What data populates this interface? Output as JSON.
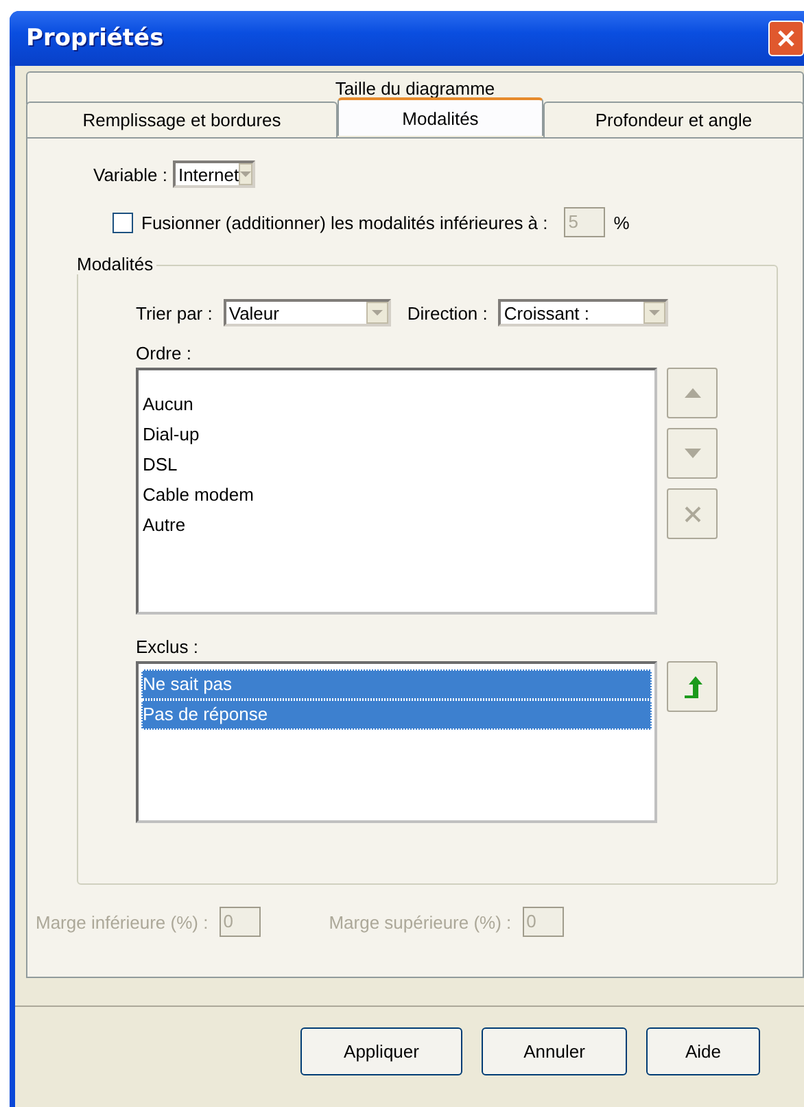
{
  "window": {
    "title": "Propriétés"
  },
  "tab_rows": [
    [
      {
        "label": "Taille du diagramme",
        "selected": false
      }
    ],
    [
      {
        "label": "Remplissage et bordures",
        "selected": false
      },
      {
        "label": "Modalités",
        "selected": true
      },
      {
        "label": "Profondeur et angle",
        "selected": false
      }
    ]
  ],
  "variable": {
    "label": "Variable :",
    "value": "Internet"
  },
  "merge": {
    "label": "Fusionner (additionner) les modalités inférieures à :",
    "checked": false,
    "value": "5",
    "unit": "%",
    "disabled": true
  },
  "group": {
    "title": "Modalités",
    "sort": {
      "label": "Trier par :",
      "value": "Valeur"
    },
    "direction": {
      "label": "Direction :",
      "value": "Croissant :"
    },
    "order": {
      "label": "Ordre :",
      "items": [
        {
          "label": "Aucun",
          "selected": false
        },
        {
          "label": "Dial-up",
          "selected": false
        },
        {
          "label": "DSL",
          "selected": false
        },
        {
          "label": "Cable modem",
          "selected": false
        },
        {
          "label": "Autre",
          "selected": false
        }
      ]
    },
    "excluded": {
      "label": "Exclus :",
      "items": [
        {
          "label": "Ne sait pas",
          "selected": true
        },
        {
          "label": "Pas de réponse",
          "selected": true
        }
      ]
    }
  },
  "margins": [
    {
      "label": "Marge inférieure (%) :",
      "value": "0",
      "disabled": true
    },
    {
      "label": "Marge supérieure (%) :",
      "value": "0",
      "disabled": true
    }
  ],
  "buttons": [
    {
      "label": "Appliquer"
    },
    {
      "label": "Annuler"
    },
    {
      "label": "Aide"
    }
  ]
}
